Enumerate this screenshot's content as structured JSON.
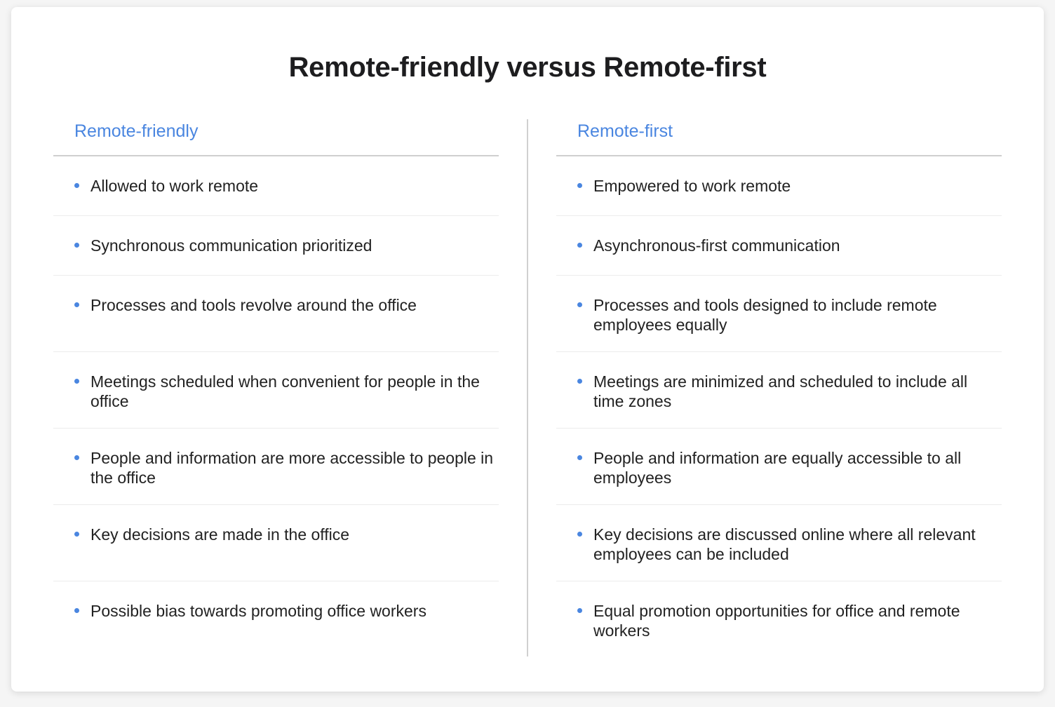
{
  "title": "Remote-friendly versus Remote-first",
  "accent_color": "#4a86e0",
  "columns": [
    {
      "heading": "Remote-friendly",
      "items": [
        "Allowed to work remote",
        "Synchronous communication prioritized",
        "Processes and tools revolve around the office",
        "Meetings scheduled when convenient for people in the office",
        "People and information are more accessible to people in the office",
        "Key decisions are made in the office",
        "Possible bias towards promoting office workers"
      ]
    },
    {
      "heading": "Remote-first",
      "items": [
        "Empowered to work remote",
        "Asynchronous-first communication",
        "Processes and tools designed to include remote employees equally",
        "Meetings are minimized and scheduled to include all time zones",
        "People and information are equally accessible to all employees",
        "Key decisions are discussed online where all relevant employees can be included",
        "Equal promotion opportunities for office and remote workers"
      ]
    }
  ]
}
